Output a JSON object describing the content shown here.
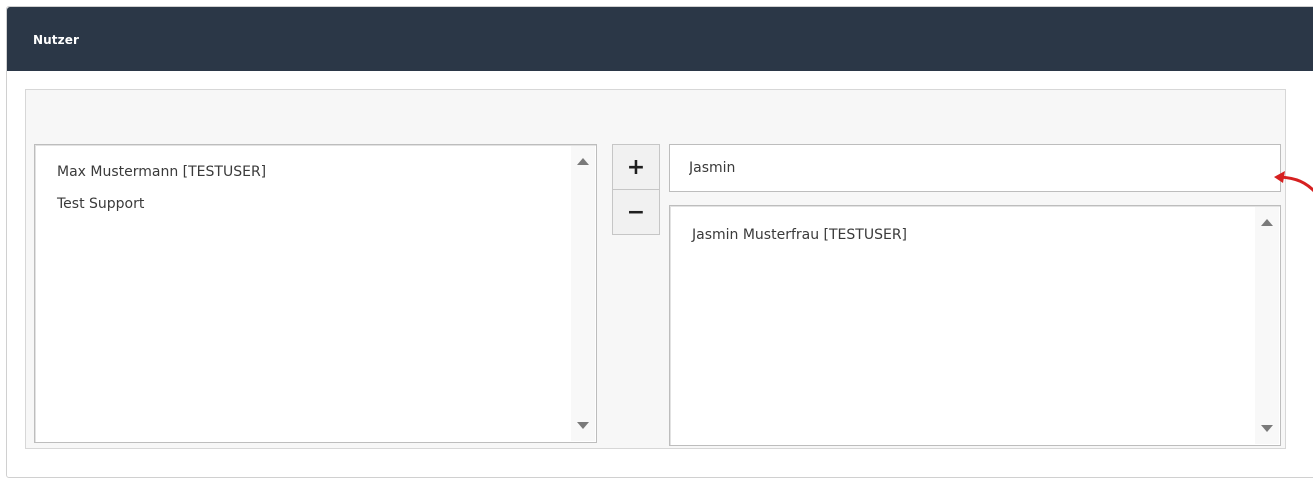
{
  "panel": {
    "title": "Nutzer"
  },
  "available_users": {
    "items": [
      {
        "label": "Max Mustermann [TESTUSER]"
      },
      {
        "label": "Test Support"
      }
    ]
  },
  "controls": {
    "add_label": "+",
    "remove_label": "−"
  },
  "search": {
    "value": "Jasmin"
  },
  "results": {
    "items": [
      {
        "label": "Jasmin Musterfrau [TESTUSER]"
      }
    ]
  },
  "annotation": {
    "color": "#d62020",
    "icon": "curved-arrow-icon"
  }
}
